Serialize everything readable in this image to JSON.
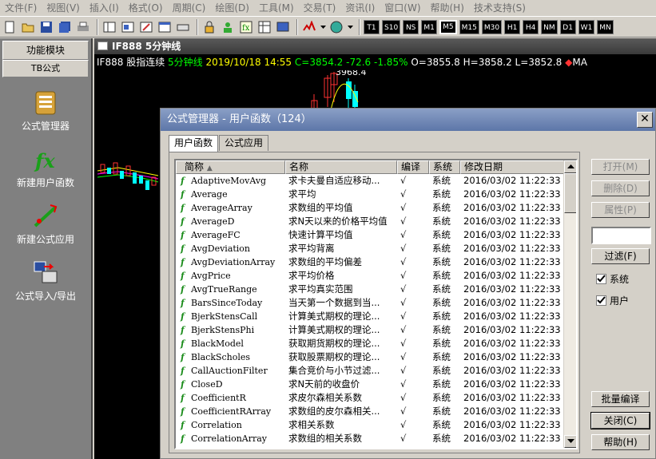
{
  "menu": [
    "文件(F)",
    "视图(V)",
    "插入(I)",
    "格式(O)",
    "周期(C)",
    "绘图(D)",
    "工具(M)",
    "交易(T)",
    "资讯(I)",
    "窗口(W)",
    "帮助(H)",
    "技术支持(S)"
  ],
  "periods": [
    {
      "label": "T1",
      "active": false
    },
    {
      "label": "S10",
      "active": false
    },
    {
      "label": "NS",
      "active": false
    },
    {
      "label": "M1",
      "active": false
    },
    {
      "label": "M5",
      "active": true
    },
    {
      "label": "M15",
      "active": false
    },
    {
      "label": "M30",
      "active": false
    },
    {
      "label": "H1",
      "active": false
    },
    {
      "label": "H4",
      "active": false
    },
    {
      "label": "NM",
      "active": false
    },
    {
      "label": "D1",
      "active": false
    },
    {
      "label": "W1",
      "active": false
    },
    {
      "label": "MN",
      "active": false
    }
  ],
  "leftpanel": {
    "header": "功能模块",
    "tab": "TB公式",
    "items": [
      {
        "label": "公式管理器",
        "icon": "formula-manager-icon"
      },
      {
        "label": "新建用户函数",
        "icon": "fx-icon"
      },
      {
        "label": "新建公式应用",
        "icon": "new-strategy-icon"
      },
      {
        "label": "公式导入/导出",
        "icon": "import-export-icon"
      }
    ]
  },
  "chart": {
    "title": "IF888 5分钟线",
    "symbol": "IF888",
    "name": "股指连续",
    "period": "5分钟线",
    "datetime": "2019/10/18 14:55",
    "close": "C=3854.2",
    "change": "-72.6",
    "change_pct": "-1.85%",
    "open": "O=3855.8",
    "high": "H=3858.2",
    "low": "L=3852.8",
    "indicator": "MA",
    "peak_label": "3968.4",
    "colors": {
      "up": "#ff3232",
      "down": "#00ffff",
      "ma1": "#ffff00",
      "ma2": "#ff00ff",
      "ma3": "#00ff00"
    }
  },
  "dialog": {
    "title": "公式管理器 - 用户函数（124）",
    "close_glyph": "✕",
    "tabs": [
      "用户函数",
      "公式应用"
    ],
    "columns": [
      "简称",
      "名称",
      "编译",
      "系统",
      "修改日期"
    ],
    "rows": [
      [
        "AdaptiveMovAvg",
        "求卡夫曼自适应移动...",
        "√",
        "系统",
        "2016/03/02  11:22:33"
      ],
      [
        "Average",
        "求平均",
        "√",
        "系统",
        "2016/03/02  11:22:33"
      ],
      [
        "AverageArray",
        "求数组的平均值",
        "√",
        "系统",
        "2016/03/02  11:22:33"
      ],
      [
        "AverageD",
        "求N天以来的价格平均值",
        "√",
        "系统",
        "2016/03/02  11:22:33"
      ],
      [
        "AverageFC",
        "快速计算平均值",
        "√",
        "系统",
        "2016/03/02  11:22:33"
      ],
      [
        "AvgDeviation",
        "求平均背离",
        "√",
        "系统",
        "2016/03/02  11:22:33"
      ],
      [
        "AvgDeviationArray",
        "求数组的平均偏差",
        "√",
        "系统",
        "2016/03/02  11:22:33"
      ],
      [
        "AvgPrice",
        "求平均价格",
        "√",
        "系统",
        "2016/03/02  11:22:33"
      ],
      [
        "AvgTrueRange",
        "求平均真实范围",
        "√",
        "系统",
        "2016/03/02  11:22:33"
      ],
      [
        "BarsSinceToday",
        "当天第一个数据到当...",
        "√",
        "系统",
        "2016/03/02  11:22:33"
      ],
      [
        "BjerkStensCall",
        "计算美式期权的理论...",
        "√",
        "系统",
        "2016/03/02  11:22:33"
      ],
      [
        "BjerkStensPhi",
        "计算美式期权的理论...",
        "√",
        "系统",
        "2016/03/02  11:22:33"
      ],
      [
        "BlackModel",
        "获取期货期权的理论...",
        "√",
        "系统",
        "2016/03/02  11:22:33"
      ],
      [
        "BlackScholes",
        "获取股票期权的理论...",
        "√",
        "系统",
        "2016/03/02  11:22:33"
      ],
      [
        "CallAuctionFilter",
        "集合竞价与小节过滤...",
        "√",
        "系统",
        "2016/03/02  11:22:33"
      ],
      [
        "CloseD",
        "求N天前的收盘价",
        "√",
        "系统",
        "2016/03/02  11:22:33"
      ],
      [
        "CoefficientR",
        "求皮尔森相关系数",
        "√",
        "系统",
        "2016/03/02  11:22:33"
      ],
      [
        "CoefficientRArray",
        "求数组的皮尔森相关...",
        "√",
        "系统",
        "2016/03/02  11:22:33"
      ],
      [
        "Correlation",
        "求相关系数",
        "√",
        "系统",
        "2016/03/02  11:22:33"
      ],
      [
        "CorrelationArray",
        "求数组的相关系数",
        "√",
        "系统",
        "2016/03/02  11:22:33"
      ]
    ],
    "buttons": {
      "open": "打开(M)",
      "delete": "删除(D)",
      "properties": "属性(P)",
      "filter": "过滤(F)",
      "batch_compile": "批量编译",
      "close": "关闭(C)",
      "help": "帮助(H)"
    },
    "filter_value": "",
    "checkboxes": [
      {
        "label": "系统",
        "checked": true
      },
      {
        "label": "用户",
        "checked": true
      }
    ]
  }
}
